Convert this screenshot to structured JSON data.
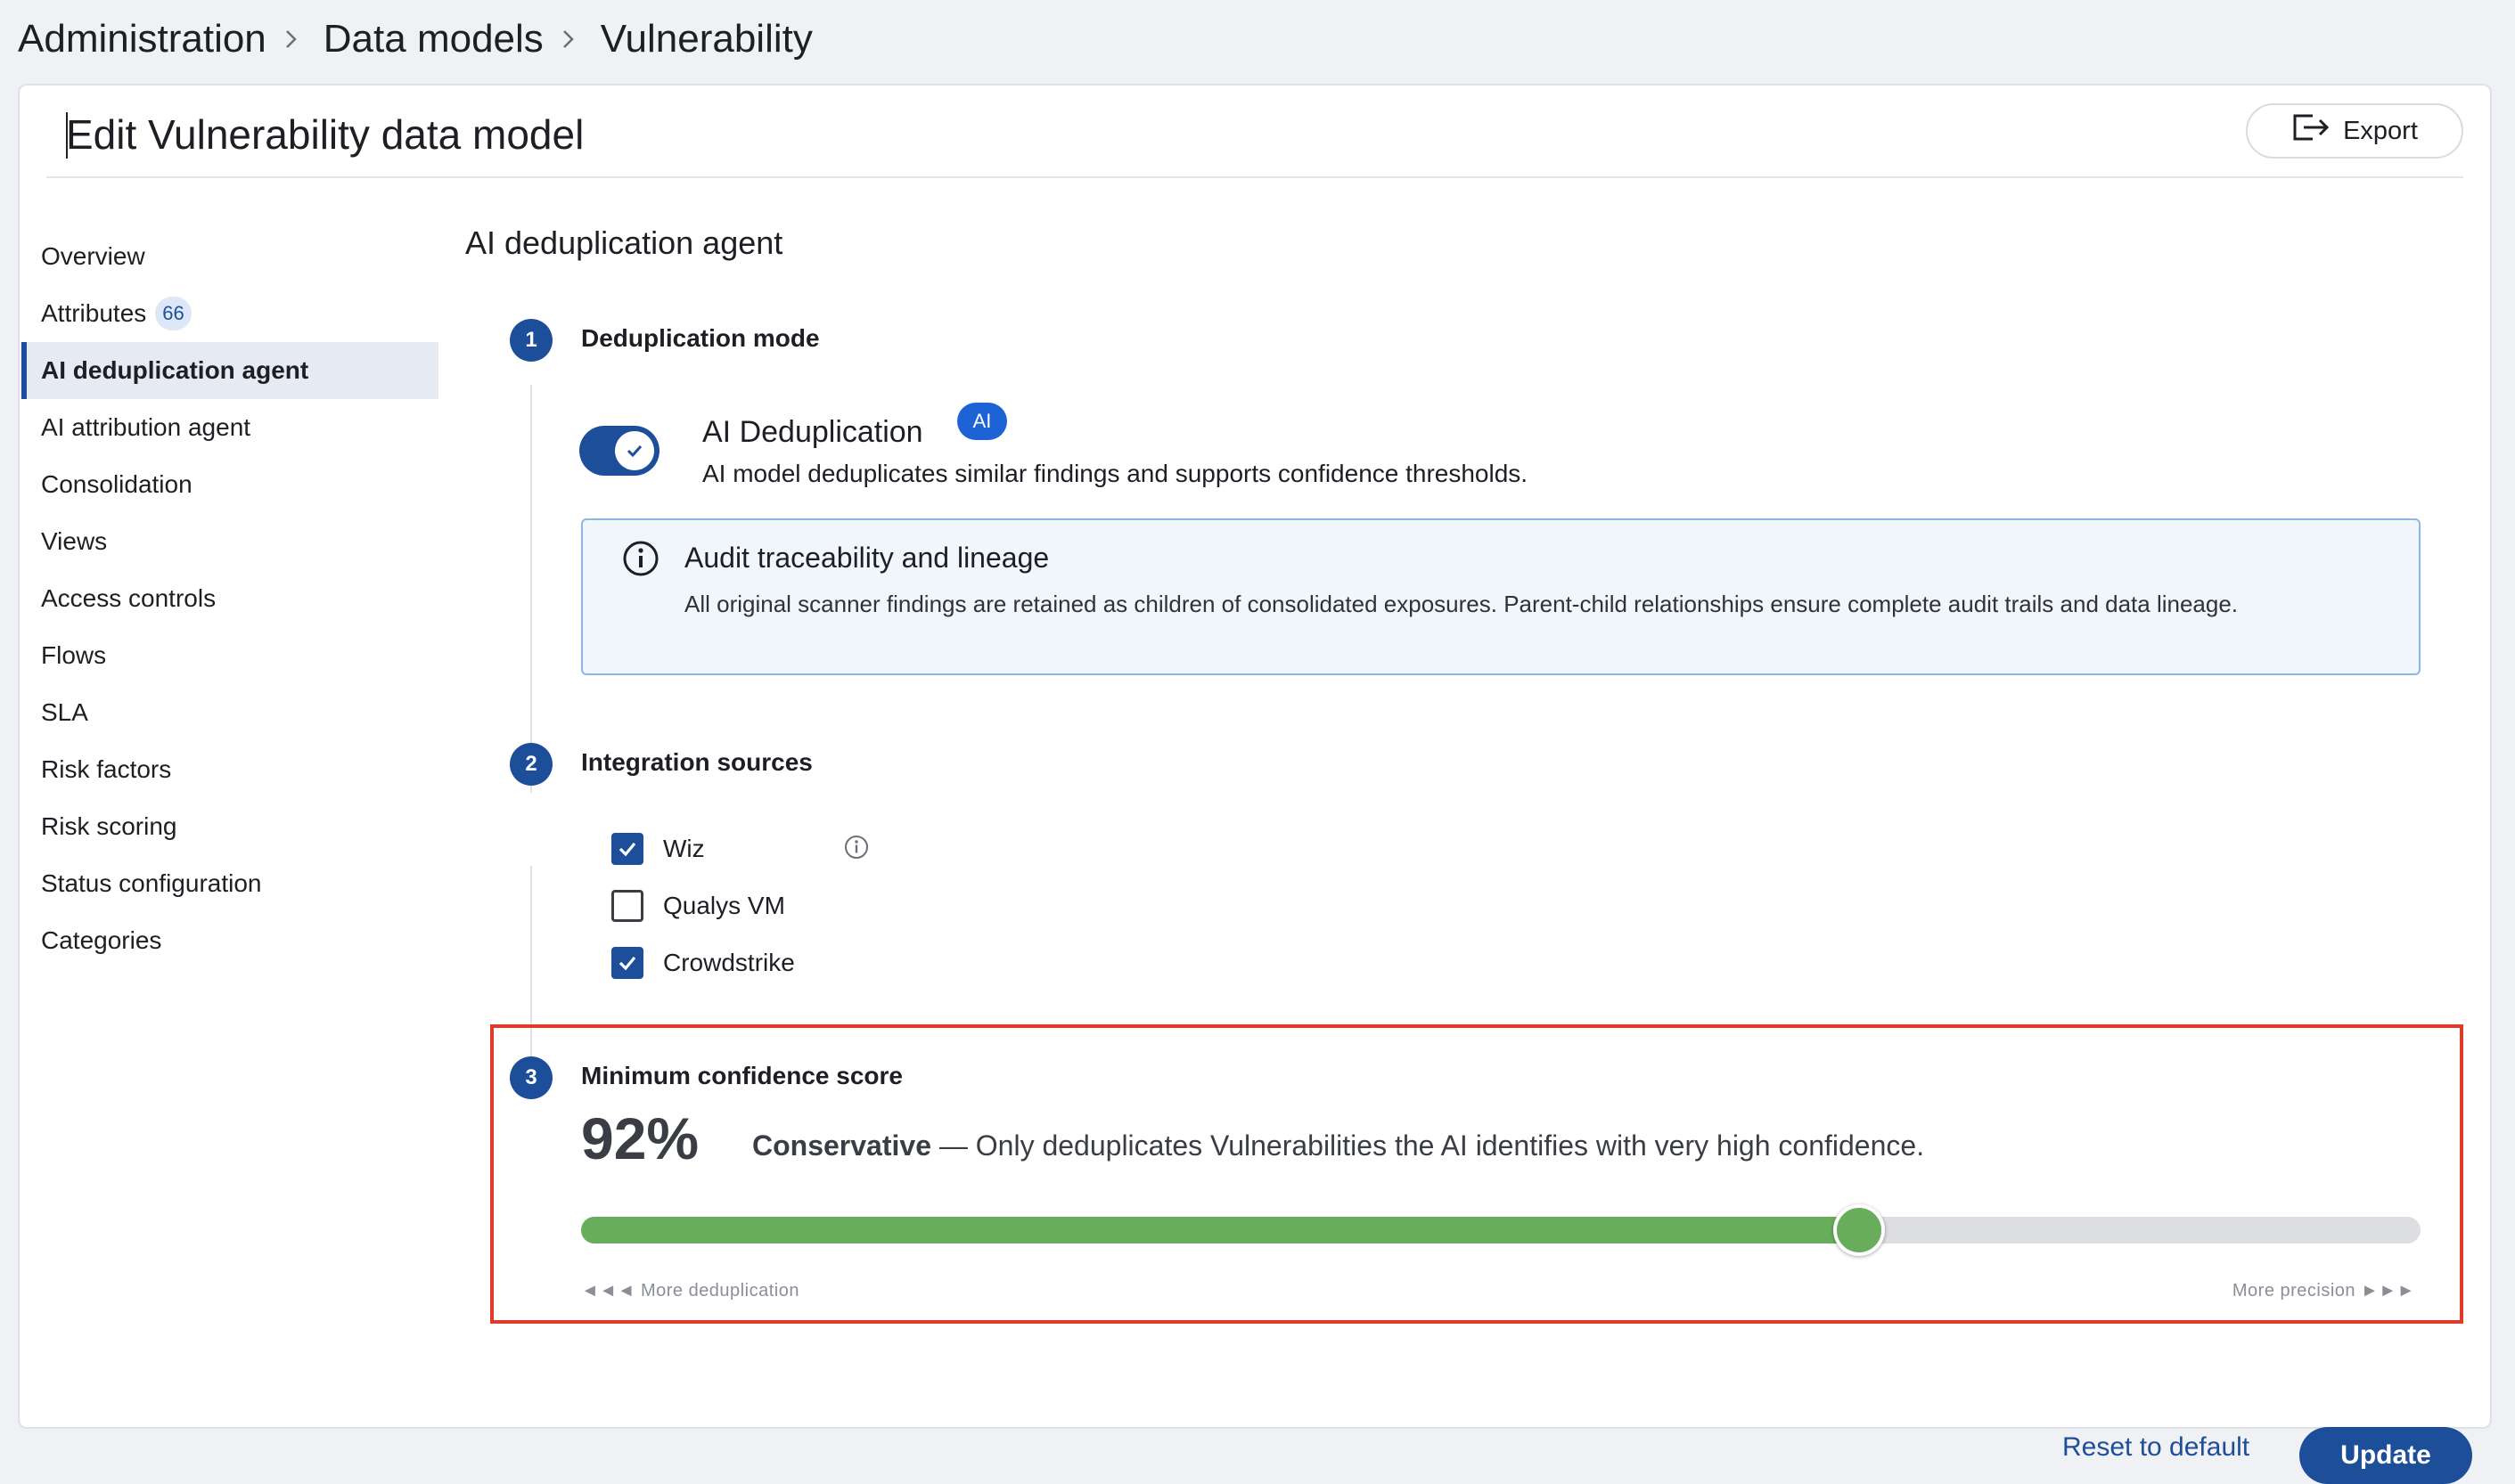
{
  "breadcrumb": {
    "items": [
      "Administration",
      "Data models",
      "Vulnerability"
    ]
  },
  "header": {
    "title": "Edit Vulnerability data model",
    "export_label": "Export",
    "export_icon": "export-icon"
  },
  "nav": {
    "items": [
      {
        "label": "Overview"
      },
      {
        "label": "Attributes",
        "badge": "66"
      },
      {
        "label": "AI deduplication agent",
        "active": true
      },
      {
        "label": "AI attribution agent"
      },
      {
        "label": "Consolidation"
      },
      {
        "label": "Views"
      },
      {
        "label": "Access controls"
      },
      {
        "label": "Flows"
      },
      {
        "label": "SLA"
      },
      {
        "label": "Risk factors"
      },
      {
        "label": "Risk scoring"
      },
      {
        "label": "Status configuration"
      },
      {
        "label": "Categories"
      }
    ]
  },
  "main": {
    "section_title": "AI deduplication agent",
    "step1": {
      "number": "1",
      "title": "Deduplication mode",
      "toggle_on": true,
      "ai_label": "AI Deduplication",
      "ai_badge": "AI",
      "ai_description": "AI model deduplicates similar findings and supports confidence thresholds.",
      "info_title": "Audit traceability and lineage",
      "info_text": "All original scanner findings are retained as children of consolidated exposures. Parent-child relationships ensure complete audit trails and data lineage."
    },
    "step2": {
      "number": "2",
      "title": "Integration sources",
      "sources": [
        {
          "label": "Wiz",
          "checked": true
        },
        {
          "label": "Qualys VM",
          "checked": false
        },
        {
          "label": "Crowdstrike",
          "checked": true
        }
      ]
    },
    "step3": {
      "number": "3",
      "title": "Minimum confidence score",
      "value_text": "92%",
      "mode": "Conservative",
      "mode_desc": " — Only deduplicates Vulnerabilities the AI identifies with very high confidence.",
      "slider_position": 0.695,
      "left_label": "◄◄◄ More deduplication",
      "right_label": "More precision ►►►"
    }
  },
  "footer": {
    "reset_label": "Reset to default",
    "update_label": "Update"
  },
  "colors": {
    "primary": "#1d4e9a",
    "slider_fill": "#67ad5b",
    "highlight": "#e03a2a",
    "info_border": "#8fb4e6"
  }
}
